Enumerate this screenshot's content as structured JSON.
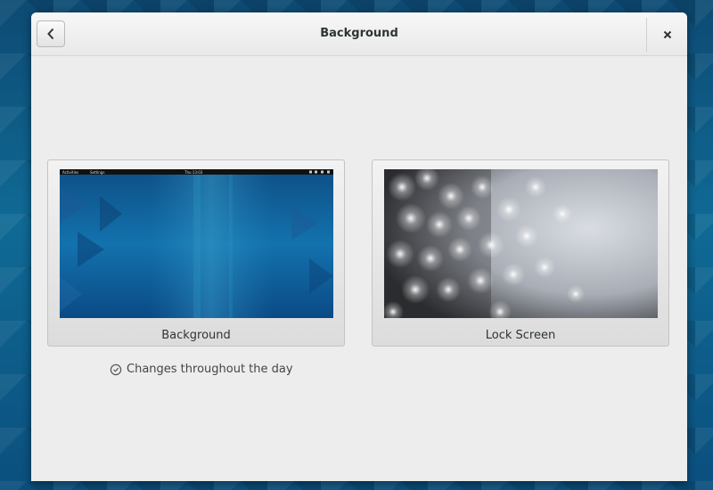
{
  "header": {
    "title": "Background",
    "back_icon": "chevron-left-icon",
    "close_icon": "close-icon"
  },
  "cards": {
    "background": {
      "label": "Background"
    },
    "lock_screen": {
      "label": "Lock Screen"
    }
  },
  "mini_topbar": {
    "activities": "Activities",
    "app": "Settings",
    "clock": "Thu 13:03"
  },
  "note": {
    "text": "Changes throughout the day",
    "icon": "clock-icon"
  },
  "colors": {
    "desktop_blue": "#0f6a95",
    "window_bg": "#ededed"
  }
}
